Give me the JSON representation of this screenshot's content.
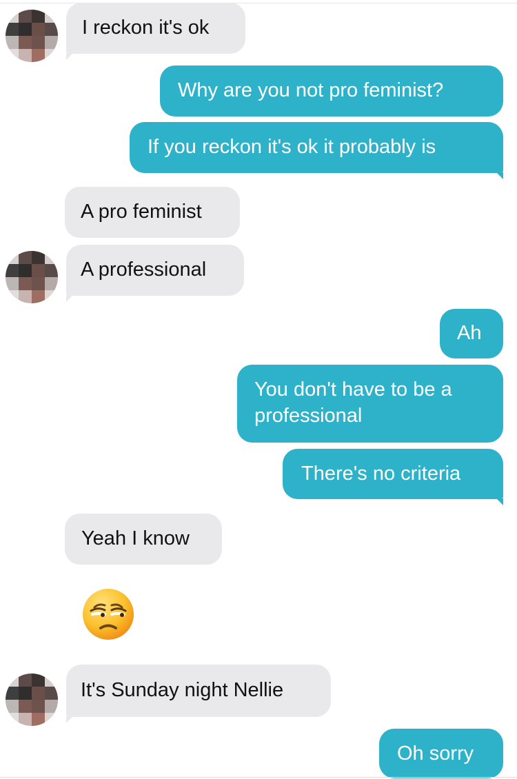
{
  "conversation": {
    "messages": [
      {
        "from": "them",
        "text": "I reckon it's ok"
      },
      {
        "from": "me",
        "text": "Why are you not pro feminist?"
      },
      {
        "from": "me",
        "text": "If you reckon it's ok it probably is"
      },
      {
        "from": "them",
        "text": "A pro feminist"
      },
      {
        "from": "them",
        "text": "A professional"
      },
      {
        "from": "me",
        "text": "Ah"
      },
      {
        "from": "me",
        "lines": [
          "You don't have to be a",
          "professional"
        ]
      },
      {
        "from": "me",
        "text": "There's no criteria"
      },
      {
        "from": "them",
        "text": "Yeah I know"
      },
      {
        "from": "them",
        "emoji": "unamused-face-emoji"
      },
      {
        "from": "them",
        "text": "It's Sunday night Nellie"
      },
      {
        "from": "me",
        "text": "Oh sorry"
      }
    ]
  },
  "colors": {
    "incoming_bubble": "#e9e9eb",
    "outgoing_bubble": "#2eb2c9",
    "incoming_text": "#111111",
    "outgoing_text": "#ffffff"
  },
  "icons": {
    "avatar": "pixelated-contact-avatar",
    "emoji": "unamused-face-emoji"
  }
}
